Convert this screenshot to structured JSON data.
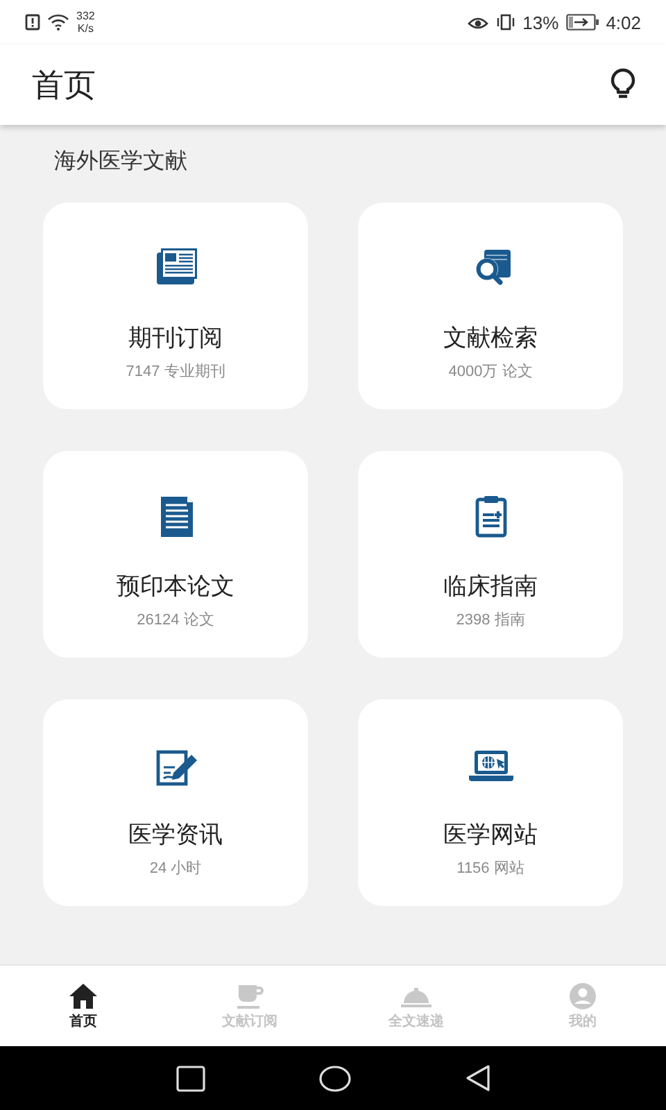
{
  "status_bar": {
    "speed_value": "332",
    "speed_unit": "K/s",
    "battery": "13%",
    "time": "4:02"
  },
  "app_bar": {
    "title": "首页"
  },
  "section": {
    "title": "海外医学文献"
  },
  "cards": [
    {
      "title": "期刊订阅",
      "subtitle": "7147 专业期刊"
    },
    {
      "title": "文献检索",
      "subtitle": "4000万 论文"
    },
    {
      "title": "预印本论文",
      "subtitle": "26124 论文"
    },
    {
      "title": "临床指南",
      "subtitle": "2398 指南"
    },
    {
      "title": "医学资讯",
      "subtitle": "24 小时"
    },
    {
      "title": "医学网站",
      "subtitle": "1156 网站"
    }
  ],
  "bottom_nav": [
    {
      "label": "首页",
      "selected": true
    },
    {
      "label": "文献订阅",
      "selected": false
    },
    {
      "label": "全文速递",
      "selected": false
    },
    {
      "label": "我的",
      "selected": false
    }
  ]
}
